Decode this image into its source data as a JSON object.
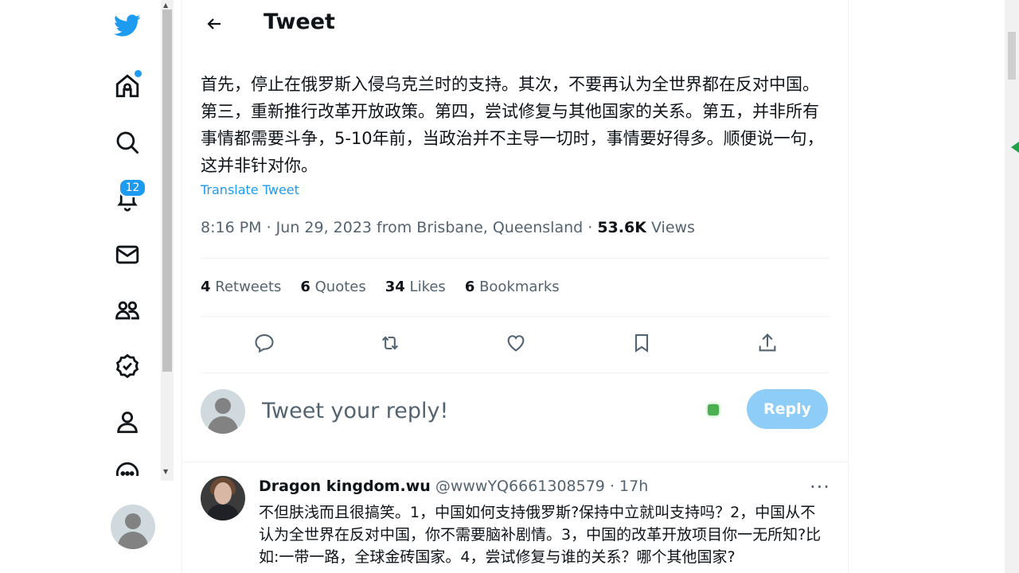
{
  "nav": {
    "items": [
      {
        "name": "twitter-logo-icon",
        "color": "#1d9bf0"
      },
      {
        "name": "home-icon"
      },
      {
        "name": "search-icon"
      },
      {
        "name": "notifications-icon"
      },
      {
        "name": "messages-icon"
      },
      {
        "name": "communities-icon"
      },
      {
        "name": "verified-icon"
      },
      {
        "name": "profile-icon"
      },
      {
        "name": "more-icon"
      }
    ],
    "notifications_badge": "12"
  },
  "header": {
    "title": "Tweet"
  },
  "tweet": {
    "text": "首先，停止在俄罗斯入侵乌克兰时的支持。其次，不要再认为全世界都在反对中国。第三，重新推行改革开放政策。第四，尝试修复与其他国家的关系。第五，并非所有事情都需要斗争，5-10年前，当政治并不主导一切时，事情要好得多。顺便说一句，这并非针对你。",
    "translate_label": "Translate Tweet",
    "time": "8:16 PM · Jun 29, 2023 from Brisbane, Queensland · ",
    "views_count": "53.6K",
    "views_label": " Views",
    "stats": {
      "retweets_count": "4",
      "retweets_label": " Retweets",
      "quotes_count": "6",
      "quotes_label": " Quotes",
      "likes_count": "34",
      "likes_label": " Likes",
      "bookmarks_count": "6",
      "bookmarks_label": " Bookmarks"
    },
    "actions": [
      "reply-icon",
      "retweet-icon",
      "like-icon",
      "bookmark-icon",
      "share-icon"
    ]
  },
  "composer": {
    "placeholder": "Tweet your reply!",
    "reply_label": "Reply"
  },
  "reply": {
    "name": "Dragon kingdom.wu",
    "handle_time": " @wwwYQ6661308579 · 17h",
    "more": "···",
    "text": "不但肤浅而且很搞笑。1，中国如何支持俄罗斯?保持中立就叫支持吗？2，中国从不认为全世界在反对中国，你不需要脑补剧情。3，中国的改革开放项目你一无所知?比如:一带一路，全球金砖国家。4，尝试修复与谁的关系？哪个其他国家?"
  },
  "colors": {
    "accent": "#1d9bf0",
    "reply_button": "#8ecdf7",
    "muted_text": "#536471"
  }
}
